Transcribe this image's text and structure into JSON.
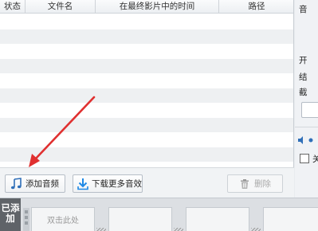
{
  "table": {
    "columns": [
      "状态",
      "文件名",
      "在最终影片中的时间",
      "路径"
    ],
    "rows": [
      "",
      "",
      "",
      "",
      "",
      "",
      "",
      "",
      "",
      "",
      ""
    ]
  },
  "toolbar": {
    "add_audio_label": "添加音频",
    "download_more_label": "下载更多音效",
    "delete_label": "删除"
  },
  "right_panel": {
    "title_fragment": "音",
    "start_fragment": "开",
    "end_fragment": "结",
    "cut_fragment": "截",
    "checkbox_fragment": "关"
  },
  "bottom": {
    "added_tab_label": "已添加",
    "thumb_hint": "双击此处"
  },
  "colors": {
    "arrow": "#e03030",
    "note_icon": "#2f6fb8",
    "download_icon": "#1e88e5",
    "added_tab_bg": "#5f6368"
  }
}
